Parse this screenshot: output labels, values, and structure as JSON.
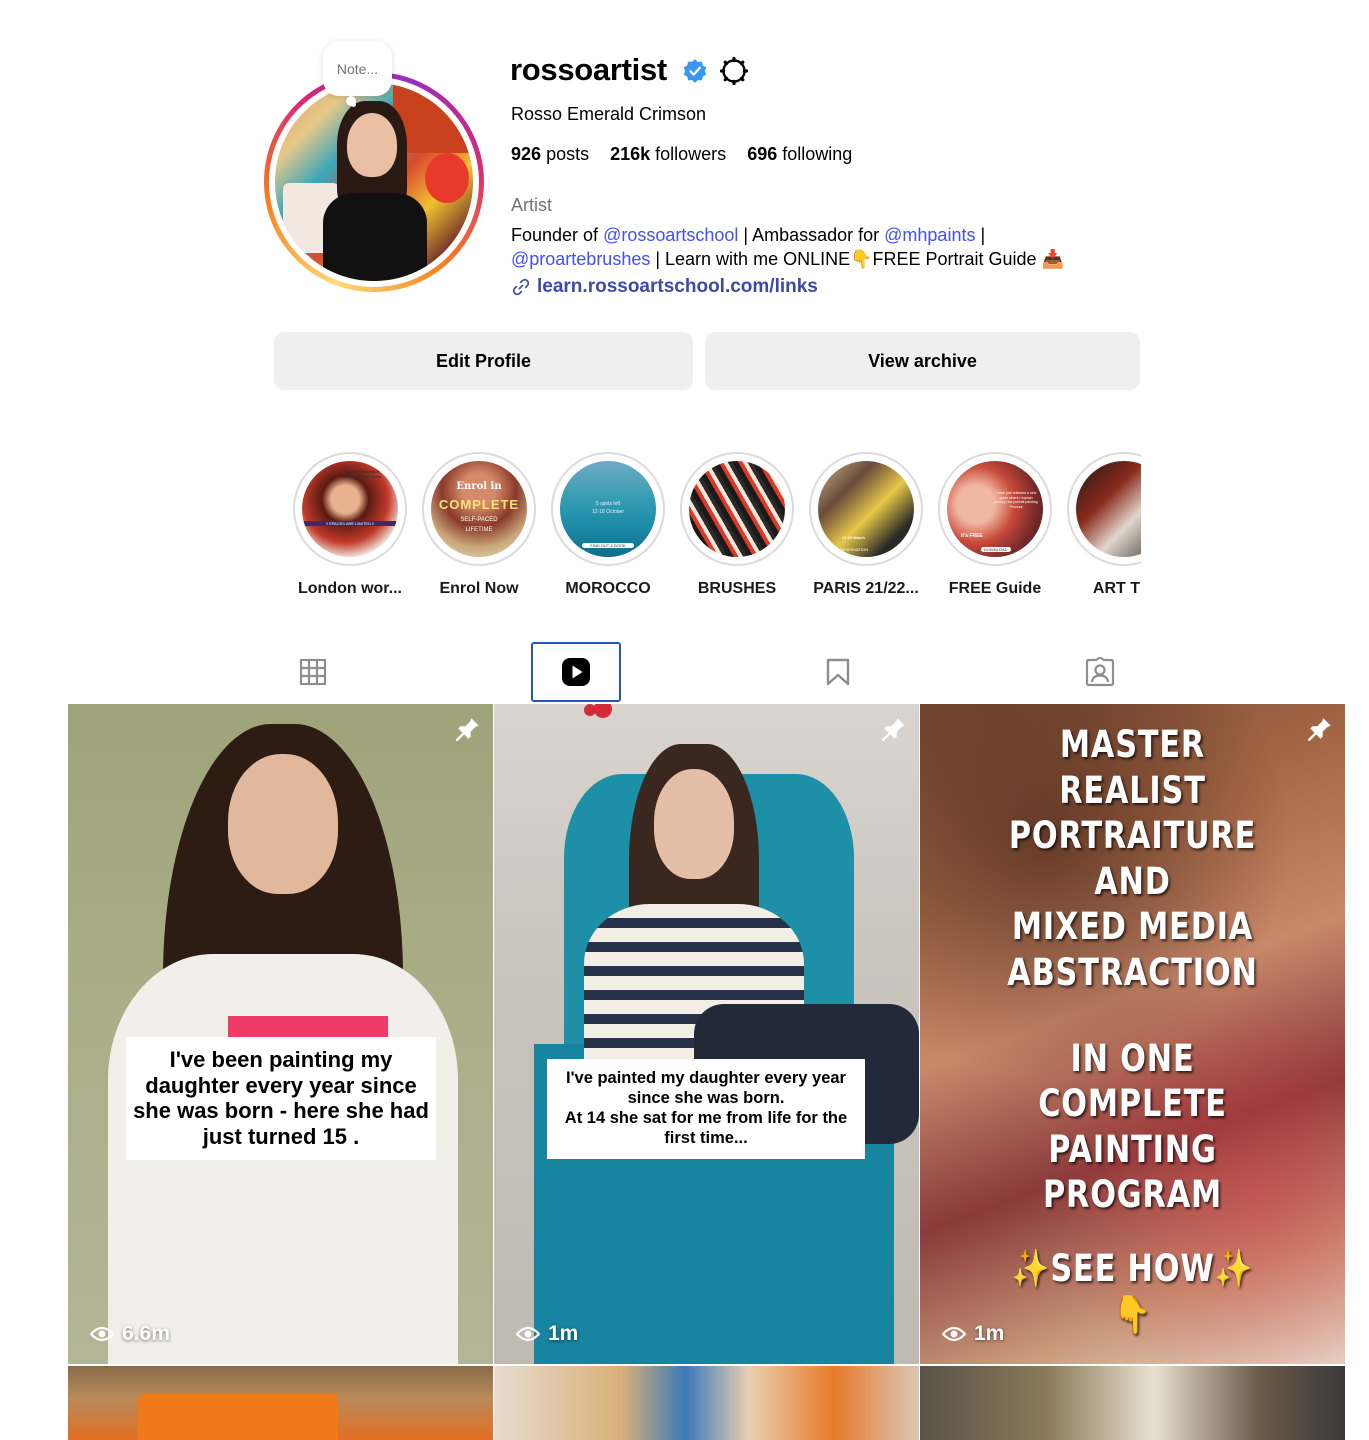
{
  "profile": {
    "username": "rossoartist",
    "full_name": "Rosso Emerald Crimson",
    "note_placeholder": "Note...",
    "stats": {
      "posts_count": "926",
      "posts_label": "posts",
      "followers_count": "216k",
      "followers_label": "followers",
      "following_count": "696",
      "following_label": "following"
    },
    "category": "Artist",
    "bio": {
      "t1": "Founder of ",
      "m1": "@rossoartschool",
      "t2": " | Ambassador for ",
      "m2": "@mhpaints",
      "t3": " |",
      "m3": "@proartebrushes",
      "t4": " | Learn with me ONLINE👇FREE Portrait Guide 📥"
    },
    "link": "learn.rossoartschool.com/links"
  },
  "actions": {
    "edit_profile": "Edit Profile",
    "view_archive": "View archive"
  },
  "highlights": [
    {
      "label": "London wor..."
    },
    {
      "label": "Enrol Now"
    },
    {
      "label": "MOROCCO"
    },
    {
      "label": "BRUSHES"
    },
    {
      "label": "PARIS 21/22..."
    },
    {
      "label": "FREE Guide"
    },
    {
      "label": "ART TIP"
    }
  ],
  "highlight_thumb_text": {
    "london_top": "Sat, 19 September London Kings Cross",
    "london_bottom": "!! SPACES ARE LIMITED !!",
    "enrol_1": "Enrol in",
    "enrol_2": "COMPLETE",
    "enrol_3": "SELF-PACED",
    "enrol_4": "LIFETIME",
    "morocco_1": "5 spots left",
    "morocco_2": "12-18 October",
    "morocco_3": "FIND OUT & BOOK",
    "paris_1": "21 22 March",
    "paris_2": "RESERVATION",
    "guide_1": "I have just released a new guide where I explain (simply) the portrait painting Process",
    "guide_2": "It's FREE",
    "guide_3": "DOWNLOAD"
  },
  "tabs": {
    "active": "reels"
  },
  "reels": [
    {
      "views": "6.6m",
      "caption": "I've been painting my daughter every year since she was born - here she had just turned 15 .",
      "pinned": true
    },
    {
      "views": "1m",
      "caption_line1": "I've painted my daughter every year",
      "caption_line2": "since she was born.",
      "caption_line3": "At 14 she sat for me from life for the",
      "caption_line4": "first time...",
      "pinned": true
    },
    {
      "views": "1m",
      "poster_lines": [
        "MASTER",
        "REALIST",
        "PORTRAITURE",
        "AND",
        "MIXED MEDIA",
        "ABSTRACTION",
        "",
        "IN ONE",
        "COMPLETE",
        "PAINTING PROGRAM",
        "",
        "✨SEE HOW✨",
        "👇"
      ],
      "pinned": true
    }
  ],
  "colors": {
    "verified_blue": "#3897f0",
    "mention_blue": "#4150f7",
    "link_blue": "#3b4aa8",
    "button_bg": "#efefef",
    "active_tab_outline": "#2754c4"
  },
  "icons": {
    "verified": "verified-badge-icon",
    "settings": "gear-icon",
    "link": "link-icon",
    "grid_tab": "grid-icon",
    "reels_tab": "reels-play-icon",
    "saved_tab": "bookmark-icon",
    "tagged_tab": "tagged-person-icon",
    "views": "eye-icon",
    "pin": "pin-icon"
  }
}
